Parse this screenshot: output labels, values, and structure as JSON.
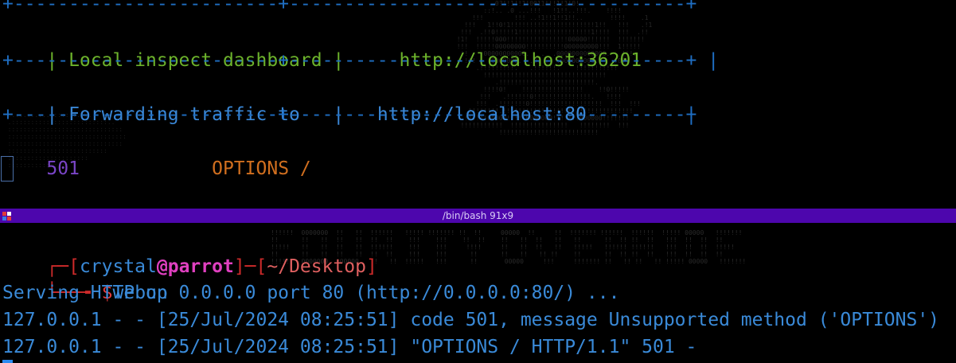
{
  "top_terminal": {
    "border_top": "+------------------------+------------------------------------+",
    "row1_label": "| Local inspect dashboard |",
    "row1_value": "http://localhost:36201",
    "row1_end": "|",
    "border_mid": "+------------------------+------------------------------------+",
    "row2_label": "| Forwarding traffic to   |",
    "row2_value": "http://localhost:80",
    "row2_end": "|",
    "border_bottom": "+------------------------+------------------------------------+",
    "request_status": "501",
    "request_method": "OPTIONS /"
  },
  "pane_title_bar": {
    "title": "/bin/bash 91x9"
  },
  "bottom_terminal": {
    "prompt_prefix": "┌─[",
    "user": "crystal",
    "at": "@",
    "host": "parrot",
    "sep": "]─[",
    "path": "~/Desktop",
    "close": "]",
    "prompt_second_prefix": "└──╼ ",
    "dollar": "$",
    "command": "webup",
    "output_lines": [
      "Serving HTTP on 0.0.0.0 port 80 (http://0.0.0.0:80/) ...",
      "127.0.0.1 - - [25/Jul/2024 08:25:51] code 501, message Unsupported method ('OPTIONS')",
      "127.0.0.1 - - [25/Jul/2024 08:25:51] \"OPTIONS / HTTP/1.1\" 501 -"
    ]
  },
  "colors": {
    "title_bar": "#4d06ad",
    "border": "#1f6fc4",
    "green_text": "#6cb22b",
    "blue_text": "#3a87d6",
    "purple_status": "#7a45c7",
    "orange_method": "#d16f1f"
  }
}
